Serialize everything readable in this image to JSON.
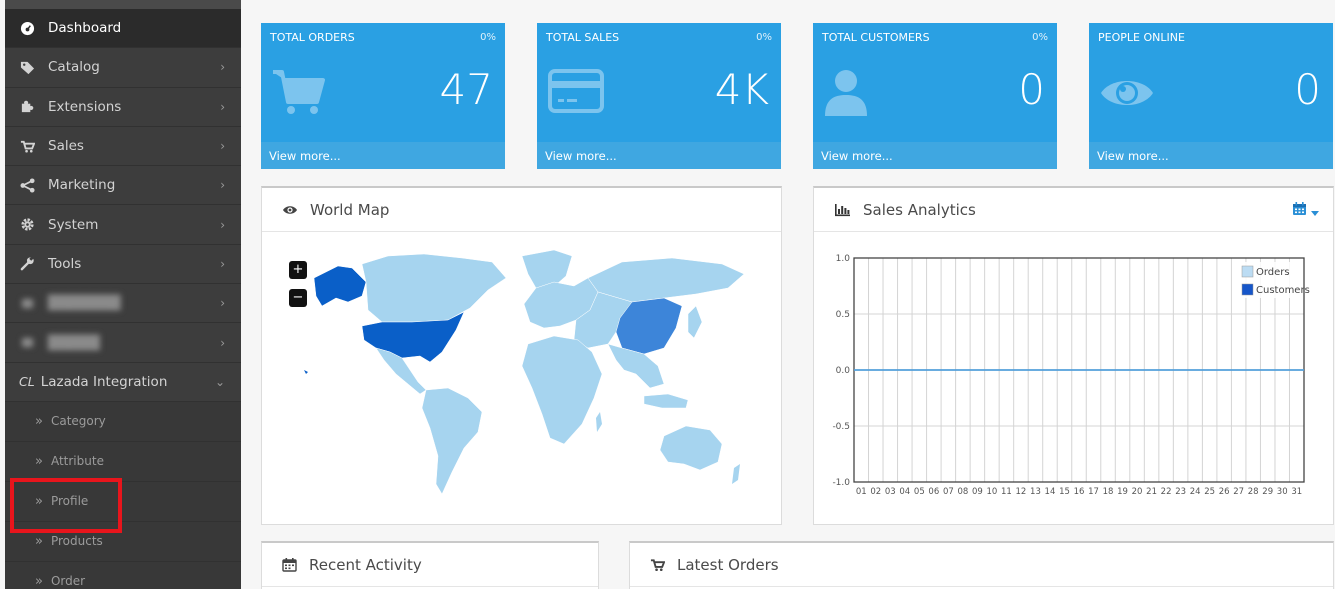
{
  "sidebar": {
    "items": [
      {
        "label": "Dashboard",
        "icon": "dashboard-icon",
        "has_chevron": false
      },
      {
        "label": "Catalog",
        "icon": "tag-icon",
        "has_chevron": true
      },
      {
        "label": "Extensions",
        "icon": "puzzle-icon",
        "has_chevron": true
      },
      {
        "label": "Sales",
        "icon": "cart-icon",
        "has_chevron": true
      },
      {
        "label": "Marketing",
        "icon": "share-icon",
        "has_chevron": true
      },
      {
        "label": "System",
        "icon": "gear-icon",
        "has_chevron": true
      },
      {
        "label": "Tools",
        "icon": "wrench-icon",
        "has_chevron": true
      }
    ],
    "lazada": {
      "prefix": "CL",
      "label": "Lazada Integration",
      "chevron": "⌄"
    },
    "sub_items": [
      {
        "label": "Category"
      },
      {
        "label": "Attribute"
      },
      {
        "label": "Profile"
      },
      {
        "label": "Products"
      },
      {
        "label": "Order"
      }
    ],
    "chevron": "›",
    "raquo": "»"
  },
  "tiles": [
    {
      "title": "TOTAL ORDERS",
      "pct": "0%",
      "value": "47",
      "footer": "View more...",
      "icon": "cart-icon"
    },
    {
      "title": "TOTAL SALES",
      "pct": "0%",
      "value": "4K",
      "footer": "View more...",
      "icon": "credit-card-icon"
    },
    {
      "title": "TOTAL CUSTOMERS",
      "pct": "0%",
      "value": "0",
      "footer": "View more...",
      "icon": "user-icon"
    },
    {
      "title": "PEOPLE ONLINE",
      "pct": "",
      "value": "0",
      "footer": "View more...",
      "icon": "eye-icon"
    }
  ],
  "world_map": {
    "title": "World Map",
    "zoom_in": "+",
    "zoom_out": "−"
  },
  "sales_analytics": {
    "title": "Sales Analytics"
  },
  "recent_activity": {
    "title": "Recent Activity"
  },
  "latest_orders": {
    "title": "Latest Orders"
  },
  "colors": {
    "tile": "#2aa0e3",
    "map_land": "#a6d4ef",
    "map_high": "#0a5fc8",
    "map_mid": "#3d85d9",
    "orders": "#bcdcf3",
    "customers": "#1656c9"
  },
  "chart_data": {
    "type": "line",
    "x": [
      "01",
      "02",
      "03",
      "04",
      "05",
      "06",
      "07",
      "08",
      "09",
      "10",
      "11",
      "12",
      "13",
      "14",
      "15",
      "16",
      "17",
      "18",
      "19",
      "20",
      "21",
      "22",
      "23",
      "24",
      "25",
      "26",
      "27",
      "28",
      "29",
      "30",
      "31"
    ],
    "series": [
      {
        "name": "Orders",
        "values": [
          0,
          0,
          0,
          0,
          0,
          0,
          0,
          0,
          0,
          0,
          0,
          0,
          0,
          0,
          0,
          0,
          0,
          0,
          0,
          0,
          0,
          0,
          0,
          0,
          0,
          0,
          0,
          0,
          0,
          0,
          0
        ]
      },
      {
        "name": "Customers",
        "values": [
          0,
          0,
          0,
          0,
          0,
          0,
          0,
          0,
          0,
          0,
          0,
          0,
          0,
          0,
          0,
          0,
          0,
          0,
          0,
          0,
          0,
          0,
          0,
          0,
          0,
          0,
          0,
          0,
          0,
          0,
          0
        ]
      }
    ],
    "ylim": [
      -1.0,
      1.0
    ],
    "yticks": [
      "1.0",
      "0.5",
      "0.0",
      "-0.5",
      "-1.0"
    ],
    "grid": true,
    "legend": "top-right"
  }
}
